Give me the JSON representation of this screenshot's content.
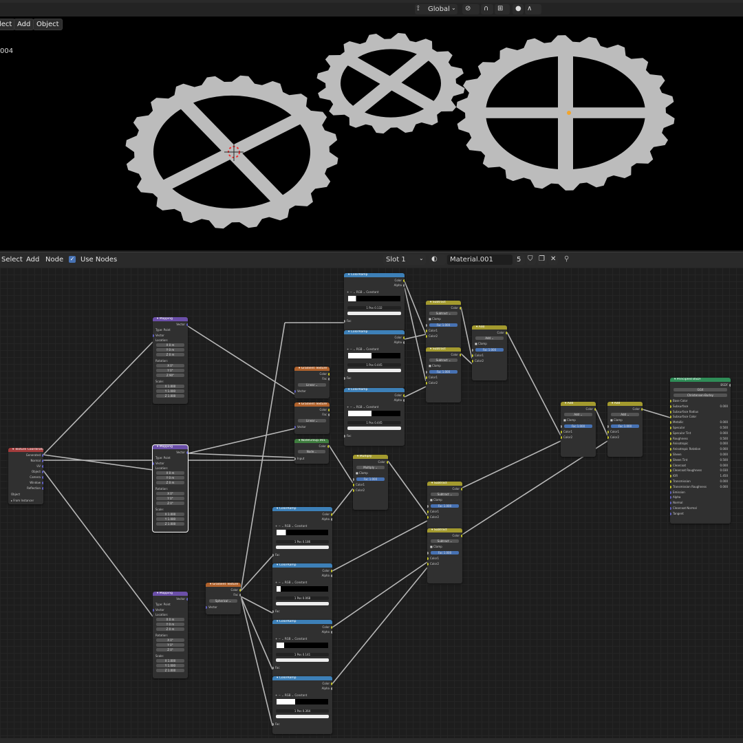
{
  "viewport": {
    "menu": [
      "lect",
      "Add",
      "Object"
    ],
    "info_text": "004",
    "orientation": "Global"
  },
  "node_editor": {
    "menu": [
      "Select",
      "Add",
      "Node"
    ],
    "use_nodes_label": "Use Nodes",
    "slot": "Slot 1",
    "material": "Material.001",
    "users": "5"
  },
  "nodes": {
    "texcoord": {
      "title": "Texture Coordinate",
      "outputs": [
        "Generated",
        "Normal",
        "UV",
        "Object",
        "Camera",
        "Window",
        "Reflection"
      ],
      "object_label": "Object",
      "from_instancer": "From Instancer"
    },
    "mapping": {
      "title": "Mapping",
      "vector": "Vector",
      "type_label": "Type:",
      "type": "Point",
      "location": "Location:",
      "rotation": "Rotation:",
      "scale": "Scale:",
      "x": "X",
      "y": "Y",
      "z": "Z",
      "loc_val": "0 m",
      "rot_val": "0°",
      "rot_z_top": "90°",
      "scale_val": "1.000"
    },
    "gradient": {
      "title": "Gradient Texture",
      "color": "Color",
      "fac": "Fac",
      "vector": "Vector",
      "linear": "Linear",
      "spherical": "Spherical"
    },
    "nodegroup": {
      "title": "NodeGroup.001",
      "color": "Color",
      "input": "Input",
      "value": "Node..."
    },
    "colorramp": {
      "title": "ColorRamp",
      "color": "Color",
      "alpha": "Alpha",
      "fac": "Fac",
      "rgb": "RGB",
      "interp": "Constant",
      "index": "1",
      "pos_label": "Pos",
      "positions": [
        "0.132",
        "0.445",
        "0.445",
        "0.186",
        "0.068",
        "0.141",
        "0.364"
      ]
    },
    "mix": {
      "subtract": "Subtract",
      "add": "Add",
      "multiply": "Multiply",
      "color": "Color",
      "clamp": "Clamp",
      "fac": "Fac",
      "fac_val": "1.000",
      "color1": "Color1",
      "color2": "Color2"
    },
    "bsdf": {
      "title": "Principled BSDF",
      "out": "BSDF",
      "ggx": "GGX",
      "sss": "Christensen-Burley",
      "rows": [
        {
          "label": "Base Color",
          "val": ""
        },
        {
          "label": "Subsurface",
          "val": "0.000"
        },
        {
          "label": "Subsurface Radius",
          "val": ""
        },
        {
          "label": "Subsurface Color",
          "val": ""
        },
        {
          "label": "Metallic",
          "val": "0.000"
        },
        {
          "label": "Specular",
          "val": "0.500"
        },
        {
          "label": "Specular Tint",
          "val": "0.000"
        },
        {
          "label": "Roughness",
          "val": "0.500"
        },
        {
          "label": "Anisotropic",
          "val": "0.000"
        },
        {
          "label": "Anisotropic Rotation",
          "val": "0.000"
        },
        {
          "label": "Sheen",
          "val": "0.000"
        },
        {
          "label": "Sheen Tint",
          "val": "0.500"
        },
        {
          "label": "Clearcoat",
          "val": "0.000"
        },
        {
          "label": "Clearcoat Roughness",
          "val": "0.030"
        },
        {
          "label": "IOR",
          "val": "1.450"
        },
        {
          "label": "Transmission",
          "val": "0.000"
        },
        {
          "label": "Transmission Roughness",
          "val": "0.000"
        },
        {
          "label": "Emission",
          "val": ""
        },
        {
          "label": "Alpha",
          "val": ""
        },
        {
          "label": "Normal",
          "val": ""
        },
        {
          "label": "Clearcoat Normal",
          "val": ""
        },
        {
          "label": "Tangent",
          "val": ""
        }
      ]
    }
  },
  "colors": {
    "input": "#a33c3c",
    "vector": "#6b4fa8",
    "texture": "#b0622c",
    "converter": "#3d80b8",
    "color": "#a39a2e",
    "shader": "#2f8d57",
    "group": "#3f7d3f"
  }
}
